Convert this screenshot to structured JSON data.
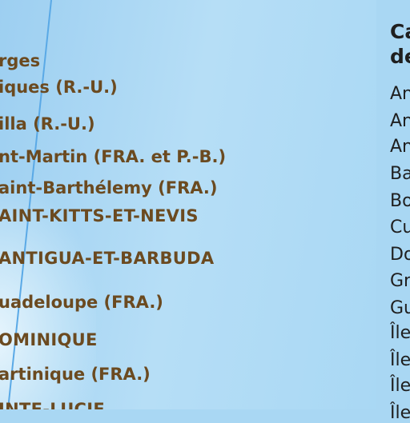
{
  "colors": {
    "sea": "#a9d7f3",
    "label": "#6b4a20",
    "legend_text": "#1f1f1f",
    "longitude_line": "#5aa9e6"
  },
  "map_labels": [
    "rges",
    "iques (R.-U.)",
    "illa (R.-U.)",
    "nt-Martin (FRA. et P.-B.)",
    "aint-Barthélemy (FRA.)",
    "AINT-KITTS-ET-NEVIS",
    "ANTIGUA-ET-BARBUDA",
    "uadeloupe (FRA.)",
    "OMINIQUE",
    "artinique (FRA.)",
    "INTE-LUCIE"
  ],
  "legend": {
    "title_line1": "Ca",
    "title_line2": "de",
    "items": [
      "An",
      "An",
      "An",
      "Ba",
      "Bo",
      "Cu",
      "Do",
      "Gr",
      "Gu",
      "Île",
      "Île",
      "Île",
      "Île"
    ]
  }
}
